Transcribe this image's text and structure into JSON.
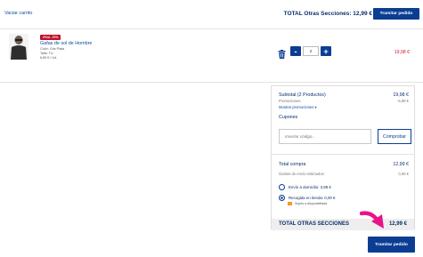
{
  "header": {
    "empty_cart_label": "Vaciar carrito",
    "total_label": "TOTAL Otras Secciones: 12,99 €",
    "checkout_label": "Tramitar pedido"
  },
  "cart": {
    "items": [
      {
        "badge": "2ªUd. -70%",
        "name": "Gafas de sol de Hombre",
        "color": "Color: Gris Plata",
        "size": "Talla: TU",
        "unit_price": "6,89 € / Ud.",
        "quantity": "2",
        "line_total": "19,98 €"
      }
    ]
  },
  "summary": {
    "subtotal_label": "Subtotal (2 Productos)",
    "subtotal_value": "19,98 €",
    "promotions_label": "Promociones",
    "promotions_value": "-6,99 €",
    "show_promotions": "Mostrar promociones",
    "coupons_title": "Cupones",
    "coupon_placeholder": "Insertar código...",
    "coupon_button": "Comprobar",
    "total_label": "Total compra",
    "total_value": "12,99 €",
    "shipping_label": "Gastos de envío estimados",
    "shipping_value": "0,00 €",
    "options": [
      {
        "label": "Envío a domicilio: 3,99 €",
        "selected": false
      },
      {
        "label": "Recogida en tienda: 0,00 €",
        "selected": true
      }
    ],
    "availability": "Sujeto a disponibilidad",
    "grand_label": "TOTAL OTRAS SECCIONES",
    "grand_value": "12,99 €"
  },
  "footer": {
    "checkout_label": "Tramitar pedido"
  },
  "icons": {
    "trash": "trash-icon",
    "minus": "minus-icon",
    "plus": "plus-icon",
    "chevron": "chevron-down-icon",
    "package": "package-icon",
    "arrow": "arrow-icon"
  },
  "colors": {
    "primary": "#0b3e93",
    "price_red": "#d3162d",
    "promo_badge": "#c0122b",
    "highlight_arrow": "#e8158a"
  }
}
